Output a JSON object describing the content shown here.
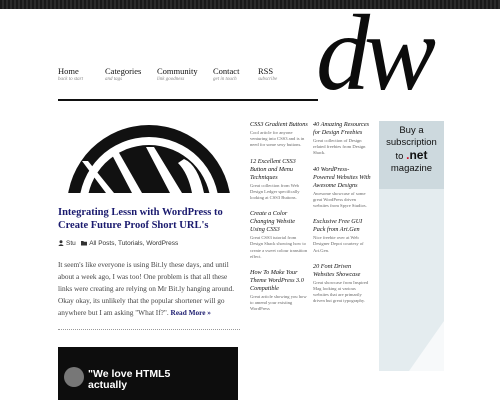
{
  "nav": {
    "items": [
      {
        "label": "Home",
        "sub": "back to start"
      },
      {
        "label": "Categories",
        "sub": "and tags"
      },
      {
        "label": "Community",
        "sub": "link goodness"
      },
      {
        "label": "Contact",
        "sub": "get in touch"
      },
      {
        "label": "RSS",
        "sub": "subscribe"
      }
    ]
  },
  "logo": {
    "text": "dw"
  },
  "post": {
    "title": "Integrating Lessn with WordPress to Create Future Proof Short URL's",
    "author": "Stu",
    "categories": "All Posts, Tutorials, WordPress",
    "excerpt": "It seem's like everyone is using Bit.ly these days, and until about a week ago, I was too! One problem is that all these links were creating are relying on Mr Bit.ly hanging around. Okay okay, its unlikely that the popular shortener will go anywhere but I am asking \"What If?\".",
    "read_more": "Read More »"
  },
  "post2": {
    "image_text_line1": "\"We love HTML5",
    "image_text_line2": "actually"
  },
  "feed_col1": [
    {
      "title": "CSS3 Gradient Buttons",
      "desc": "Cool article for anyone venturing into CSS3 and is in need for some sexy buttons."
    },
    {
      "title": "12 Excellent CSS3 Button and Menu Techniques",
      "desc": "Great collection from Web Design Ledger specifically looking at CSS3 Buttons."
    },
    {
      "title": "Create a Color Changing Website Using CSS3",
      "desc": "Great CSS3 tutorial from Design Shack showing how to create a sweet colour transition effect."
    },
    {
      "title": "How To Make Your Theme WordPress 3.0 Compatible",
      "desc": "Great article showing you how to amend your existing WordPress"
    }
  ],
  "feed_col2": [
    {
      "title": "40 Amazing Resources for Design Freebies",
      "desc": "Great collection of Design related freebies from Design Shack."
    },
    {
      "title": "40 WordPress-Powered Websites With Awesome Designs",
      "desc": "Awesome showcase of some great WordPress driven websites from Spyre Studios."
    },
    {
      "title": "Exclusive Free GUI Pack from Art.Gen",
      "desc": "Nice freebie over at Web Designer Depot courtesy of Art.Gen."
    },
    {
      "title": "20 Font Driven Websites Showcase",
      "desc": "Great showcase from Inspired Mag looking at various websites that are primarily driven but great typography."
    }
  ],
  "ad": {
    "line1": "Buy a",
    "line2": "subscription",
    "line3_prefix": "to",
    "brand_dot": ".",
    "brand": "net",
    "line4": "magazine"
  },
  "colors": {
    "link": "#1a1a6e",
    "ad_bg": "#cdd9de",
    "brand_red": "#d0112b"
  },
  "icons": {
    "author": "user-icon",
    "categories": "folder-icon"
  }
}
